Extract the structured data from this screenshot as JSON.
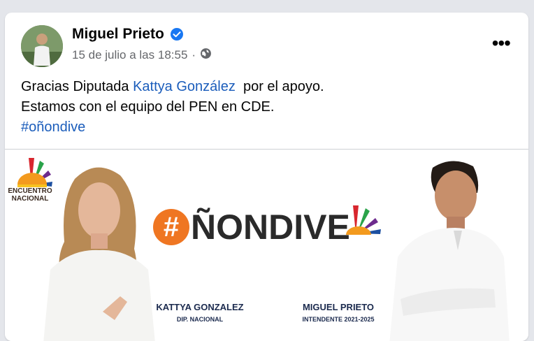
{
  "post": {
    "author": "Miguel Prieto",
    "timestamp": "15 de julio a las 18:55",
    "audience_icon": "globe-icon",
    "verified_icon": "verified-badge-icon",
    "more_label": "•••",
    "text": {
      "line1_prefix": "Gracias Diputada ",
      "mention": "Kattya González",
      "line1_suffix": "  por el apoyo.",
      "line2": "Estamos con el equipo del PEN en CDE.",
      "hashtag": "#oñondive"
    }
  },
  "image": {
    "logo_text_1": "ENCUENTRO",
    "logo_text_2": "NACIONAL",
    "banner_hash": "#",
    "banner_word": "ÑONDIVE",
    "candidate_left_name": "KATTYA GONZALEZ",
    "candidate_left_role": "DIP. NACIONAL",
    "candidate_right_name": "MIGUEL PRIETO",
    "candidate_right_role": "INTENDENTE 2021-2025"
  },
  "colors": {
    "link": "#1b5dbb",
    "verified": "#1877f2",
    "hash_orange": "#ef7622"
  }
}
